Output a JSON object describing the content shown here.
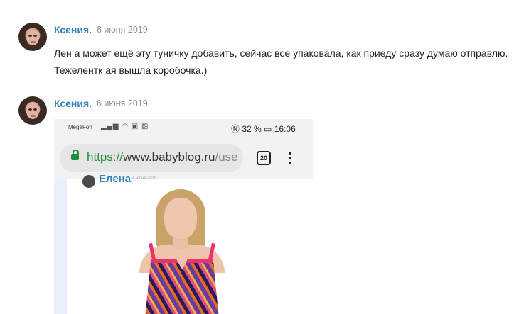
{
  "comments": [
    {
      "author": "Ксения.",
      "date": "6 июня 2019",
      "text_lines": [
        "Лен а может ещё эту туничку добавить, сейчас все упаковала, как приеду сразу думаю отправлю.",
        "Тежелентк ая вышла коробочка.)"
      ]
    },
    {
      "author": "Ксения.",
      "date": "6 июня 2019",
      "attachment": {
        "status_bar": {
          "carrier": "MegaFon",
          "battery": "32 %",
          "time": "16:06"
        },
        "address_bar": {
          "scheme": "https://",
          "host": "www.babyblog.ru",
          "path": "/use"
        },
        "tab_count": "20",
        "embedded_author": "Елена",
        "embedded_date": "4 июня 2019"
      }
    }
  ]
}
